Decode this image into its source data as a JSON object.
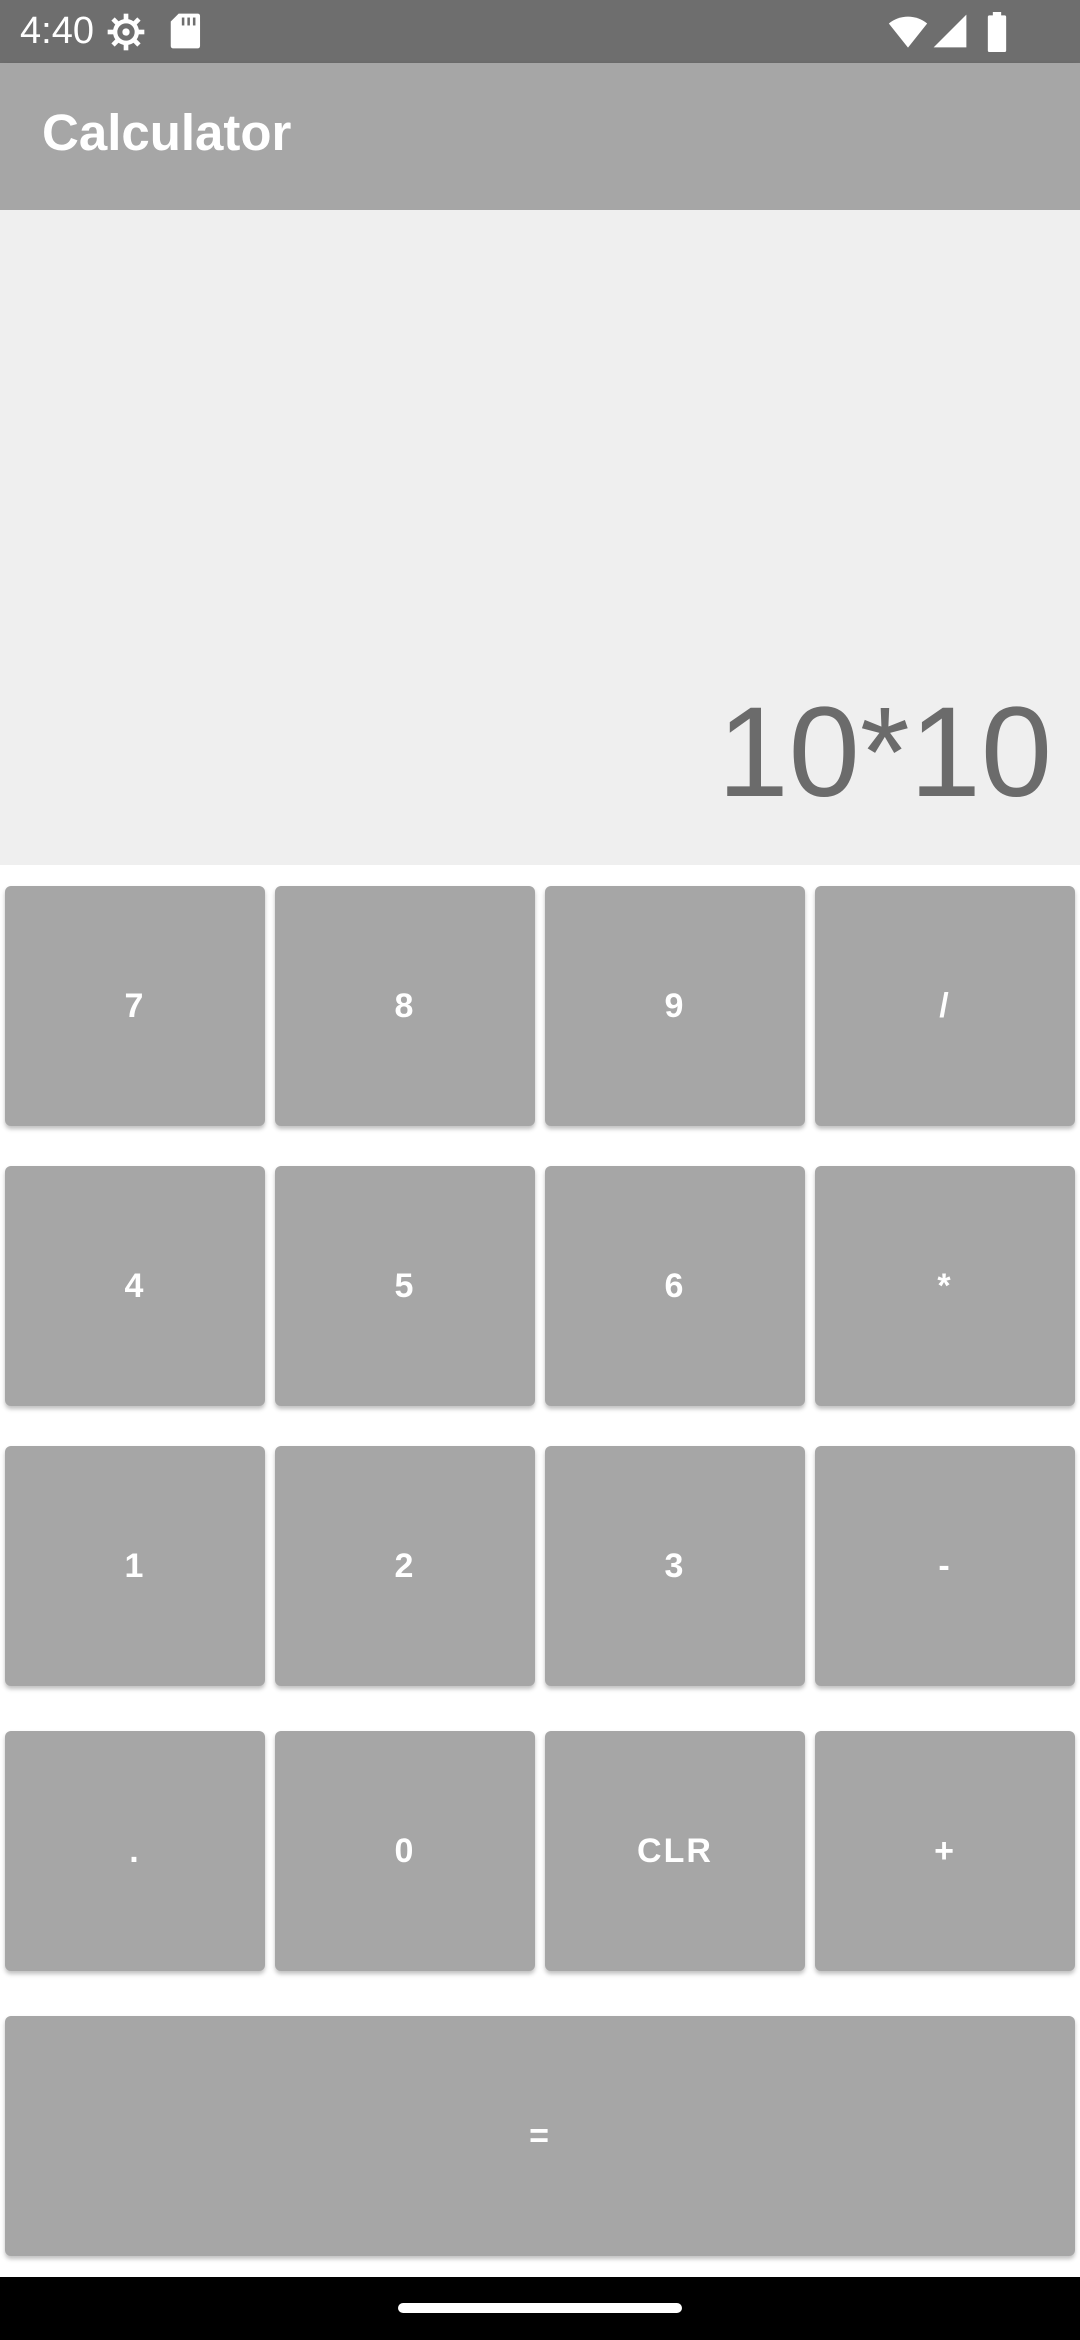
{
  "status_bar": {
    "time": "4:40",
    "icons": [
      "settings-icon",
      "sd-card-icon",
      "wifi-icon",
      "signal-icon",
      "battery-icon"
    ]
  },
  "app_bar": {
    "title": "Calculator"
  },
  "display": {
    "expression": "10*10"
  },
  "keys": {
    "k7": "7",
    "k8": "8",
    "k9": "9",
    "divide": "/",
    "k4": "4",
    "k5": "5",
    "k6": "6",
    "multiply": "*",
    "k1": "1",
    "k2": "2",
    "k3": "3",
    "subtract": "-",
    "dot": ".",
    "k0": "0",
    "clear": "CLR",
    "add": "+",
    "equals": "="
  },
  "colors": {
    "app_bar": "#a6a6a6",
    "status_bar": "#6e6e6e",
    "key": "#a6a6a6",
    "display_bg": "#efefef",
    "display_text": "#6b6b6b"
  }
}
